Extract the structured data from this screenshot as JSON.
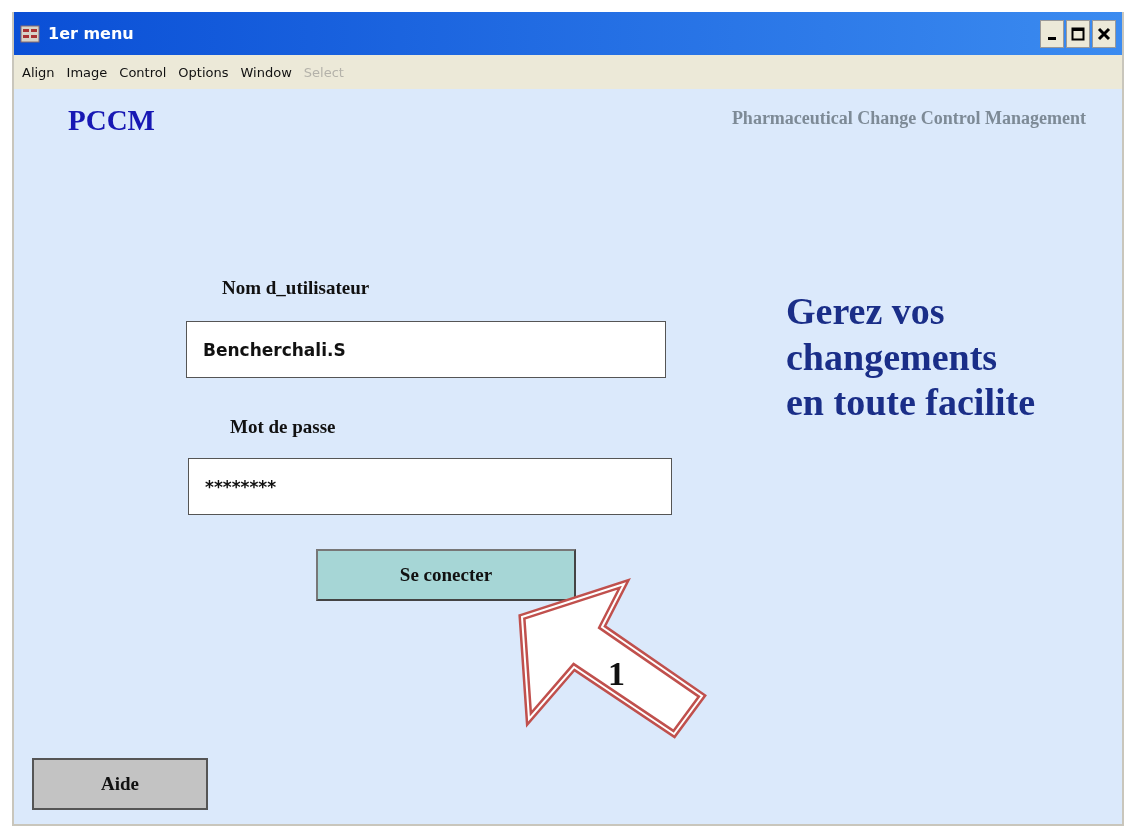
{
  "window": {
    "title": "1er menu"
  },
  "menu": [
    {
      "label": "Align",
      "disabled": false
    },
    {
      "label": "Image",
      "disabled": false
    },
    {
      "label": "Control",
      "disabled": false
    },
    {
      "label": "Options",
      "disabled": false
    },
    {
      "label": "Window",
      "disabled": false
    },
    {
      "label": "Select",
      "disabled": true
    }
  ],
  "header": {
    "logo": "PCCM",
    "subtitle": "Pharmaceutical Change Control Management"
  },
  "login": {
    "username_label": "Nom d_utilisateur",
    "username_value": "Bencherchali.S",
    "password_label": "Mot de passe",
    "password_value": "********",
    "submit": "Se conecter"
  },
  "slogan": [
    "Gerez vos",
    "changements",
    "en toute facilite"
  ],
  "callout": {
    "label": "1"
  },
  "help_button": "Aide"
}
